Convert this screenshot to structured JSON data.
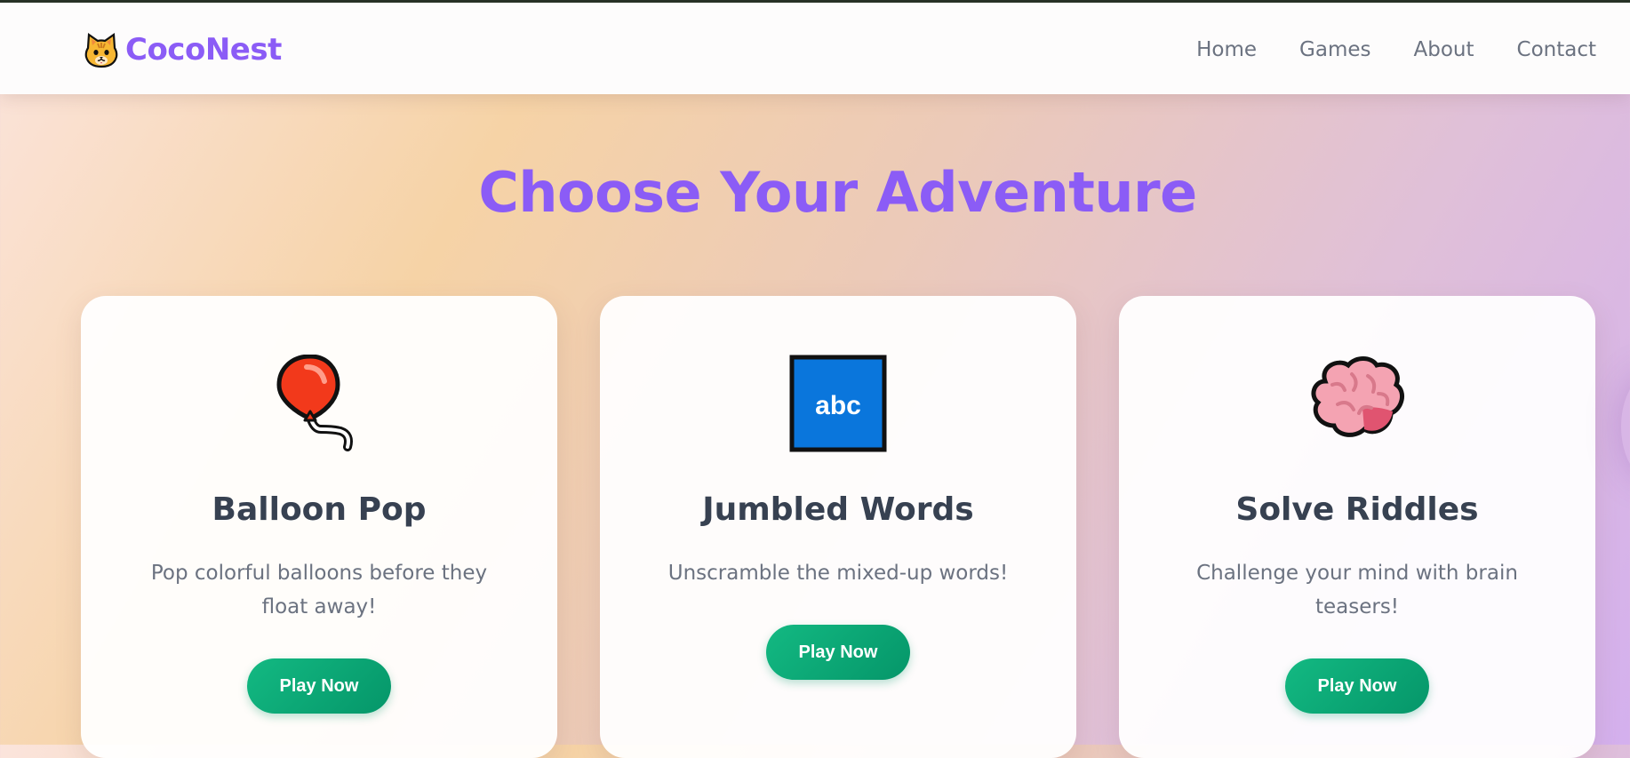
{
  "brand": {
    "name": "CocoNest",
    "logo_icon": "cat-face-icon",
    "color": "#8b5cf6"
  },
  "nav": {
    "items": [
      {
        "label": "Home"
      },
      {
        "label": "Games"
      },
      {
        "label": "About"
      },
      {
        "label": "Contact"
      }
    ]
  },
  "hero": {
    "title": "Choose Your Adventure"
  },
  "games": [
    {
      "icon": "balloon-icon",
      "title": "Balloon Pop",
      "description": "Pop colorful balloons before they float away!",
      "button": "Play Now"
    },
    {
      "icon": "abc-input-icon",
      "title": "Jumbled Words",
      "description": "Unscramble the mixed-up words!",
      "button": "Play Now"
    },
    {
      "icon": "brain-icon",
      "title": "Solve Riddles",
      "description": "Challenge your mind with brain teasers!",
      "button": "Play Now"
    }
  ],
  "colors": {
    "accent": "#8b5cf6",
    "button": "#10b981",
    "heading": "#374151",
    "body_text": "#6b7280"
  }
}
